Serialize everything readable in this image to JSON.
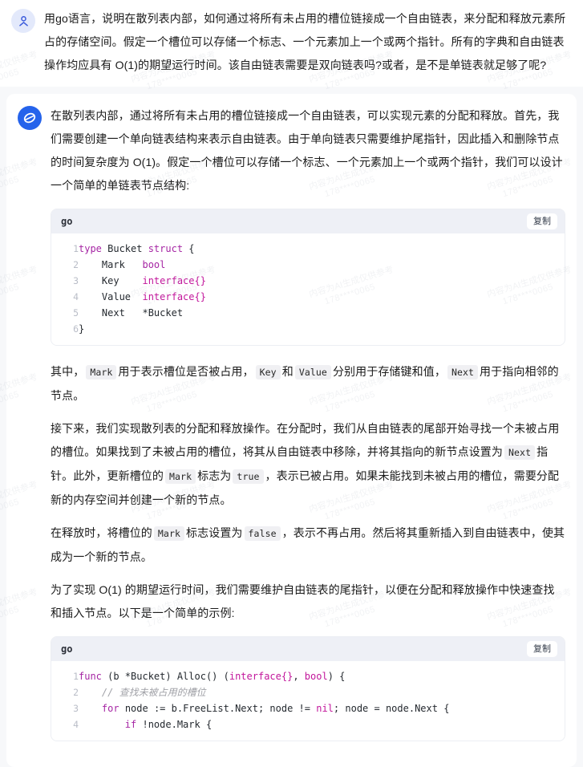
{
  "watermark": {
    "line1": "内容为AI生成仅供参考",
    "line2": "178****0065"
  },
  "user_message": {
    "avatar_icon": "person-icon",
    "text": "用go语言，说明在散列表内部，如何通过将所有未占用的槽位链接成一个自由链表，来分配和释放元素所占的存储空间。假定一个槽位可以存储一个标志、一个元素加上一个或两个指针。所有的字典和自由链表操作均应具有 O(1)的期望运行时间。该自由链表需要是双向链表吗?或者，是不是单链表就足够了呢?"
  },
  "assistant_message": {
    "avatar_icon": "assistant-logo-icon",
    "paragraphs": {
      "p1": "在散列表内部，通过将所有未占用的槽位链接成一个自由链表，可以实现元素的分配和释放。首先，我们需要创建一个单向链表结构来表示自由链表。由于单向链表只需要维护尾指针，因此插入和删除节点的时间复杂度为 O(1)。假定一个槽位可以存储一个标志、一个元素加上一个或两个指针，我们可以设计一个简单的单链表节点结构:",
      "p2_a": "其中，",
      "p2_code1": "Mark",
      "p2_b": "用于表示槽位是否被占用，",
      "p2_code2": "Key",
      "p2_c": "和",
      "p2_code3": "Value",
      "p2_d": "分别用于存储键和值，",
      "p2_code4": "Next",
      "p2_e": "用于指向相邻的节点。",
      "p3_a": "接下来，我们实现散列表的分配和释放操作。在分配时，我们从自由链表的尾部开始寻找一个未被占用的槽位。如果找到了未被占用的槽位，将其从自由链表中移除，并将其指向的新节点设置为",
      "p3_code1": "Next",
      "p3_b": "指针。此外，更新槽位的",
      "p3_code2": "Mark",
      "p3_c": "标志为",
      "p3_code3": "true",
      "p3_d": "，表示已被占用。如果未能找到未被占用的槽位，需要分配新的内存空间并创建一个新的节点。",
      "p4_a": "在释放时，将槽位的",
      "p4_code1": "Mark",
      "p4_b": "标志设置为",
      "p4_code2": "false",
      "p4_c": "，表示不再占用。然后将其重新插入到自由链表中，使其成为一个新的节点。",
      "p5": "为了实现 O(1) 的期望运行时间，我们需要维护自由链表的尾指针，以便在分配和释放操作中快速查找和插入节点。以下是一个简单的示例:"
    },
    "code_blocks": [
      {
        "language": "go",
        "copy_label": "复制",
        "lines": [
          {
            "n": "1",
            "tokens": [
              {
                "t": "type ",
                "c": "k"
              },
              {
                "t": "Bucket ",
                "c": "id"
              },
              {
                "t": "struct",
                "c": "k"
              },
              {
                "t": " {",
                "c": "id"
              }
            ]
          },
          {
            "n": "2",
            "tokens": [
              {
                "t": "    Mark   ",
                "c": "id"
              },
              {
                "t": "bool",
                "c": "k"
              }
            ]
          },
          {
            "n": "3",
            "tokens": [
              {
                "t": "    Key    ",
                "c": "id"
              },
              {
                "t": "interface{}",
                "c": "ty"
              }
            ]
          },
          {
            "n": "4",
            "tokens": [
              {
                "t": "    Value  ",
                "c": "id"
              },
              {
                "t": "interface{}",
                "c": "ty"
              }
            ]
          },
          {
            "n": "5",
            "tokens": [
              {
                "t": "    Next   *Bucket",
                "c": "id"
              }
            ]
          },
          {
            "n": "6",
            "tokens": [
              {
                "t": "}",
                "c": "id"
              }
            ]
          }
        ]
      },
      {
        "language": "go",
        "copy_label": "复制",
        "lines": [
          {
            "n": "1",
            "tokens": [
              {
                "t": "func",
                "c": "k"
              },
              {
                "t": " (b *Bucket) Alloc() (",
                "c": "id"
              },
              {
                "t": "interface{}",
                "c": "ty"
              },
              {
                "t": ", ",
                "c": "id"
              },
              {
                "t": "bool",
                "c": "ty"
              },
              {
                "t": ") {",
                "c": "id"
              }
            ]
          },
          {
            "n": "2",
            "tokens": [
              {
                "t": "    // 查找未被占用的槽位",
                "c": "cm"
              }
            ]
          },
          {
            "n": "3",
            "tokens": [
              {
                "t": "    ",
                "c": "id"
              },
              {
                "t": "for",
                "c": "k"
              },
              {
                "t": " node := b.FreeList.Next; node != ",
                "c": "id"
              },
              {
                "t": "nil",
                "c": "ty"
              },
              {
                "t": "; node = node.Next {",
                "c": "id"
              }
            ]
          },
          {
            "n": "4",
            "tokens": [
              {
                "t": "        ",
                "c": "id"
              },
              {
                "t": "if",
                "c": "k"
              },
              {
                "t": " !node.Mark {",
                "c": "id"
              }
            ]
          }
        ]
      }
    ]
  }
}
